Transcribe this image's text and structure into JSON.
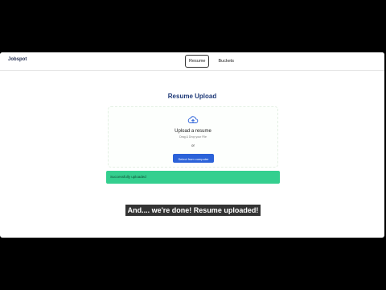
{
  "navbar": {
    "brand": "Jobspot",
    "tabs": [
      {
        "label": "Resume",
        "active": true
      },
      {
        "label": "Buckets",
        "active": false
      }
    ]
  },
  "main": {
    "title": "Resume Upload",
    "dropzone": {
      "icon": "cloud-upload-icon",
      "title": "Upload a resume",
      "hint": "Drag & Drop your File",
      "or": "or",
      "button_label": "Select from computer"
    },
    "alert": {
      "text": "Successfully uploaded",
      "color": "#34cf8f"
    }
  },
  "caption": "And.... we're done! Resume uploaded!",
  "colors": {
    "accent": "#2b62d9",
    "title": "#1f3a78",
    "success": "#34cf8f"
  }
}
